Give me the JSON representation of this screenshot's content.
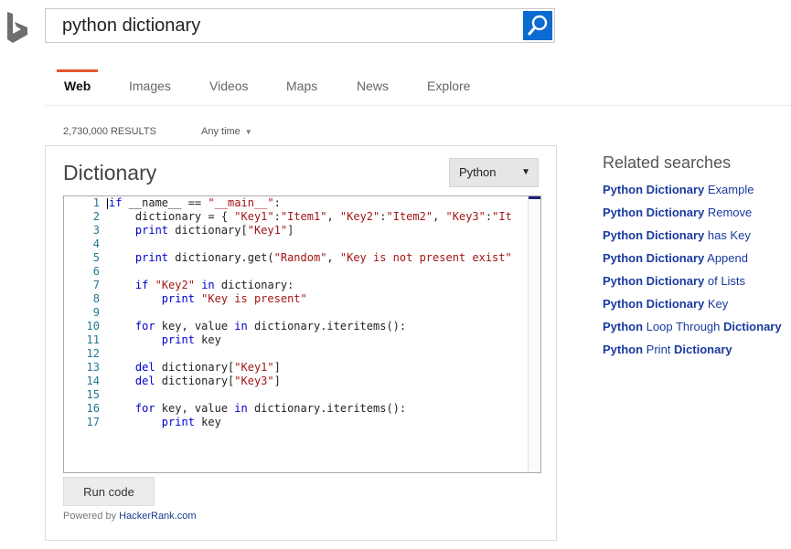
{
  "search": {
    "query": "python dictionary"
  },
  "tabs": [
    {
      "label": "Web",
      "active": true
    },
    {
      "label": "Images",
      "active": false
    },
    {
      "label": "Videos",
      "active": false
    },
    {
      "label": "Maps",
      "active": false
    },
    {
      "label": "News",
      "active": false
    },
    {
      "label": "Explore",
      "active": false
    }
  ],
  "results": {
    "count": "2,730,000 RESULTS",
    "time_filter": "Any time"
  },
  "answer": {
    "title": "Dictionary",
    "language": "Python",
    "run_label": "Run code",
    "powered_prefix": "Powered by ",
    "powered_link": "HackerRank.com",
    "code_lines": [
      {
        "n": "1",
        "parts": [
          [
            "kw",
            "if"
          ],
          [
            "t",
            " __name__ == "
          ],
          [
            "str",
            "\"__main__\""
          ],
          [
            "t",
            ":"
          ]
        ]
      },
      {
        "n": "2",
        "parts": [
          [
            "t",
            "    dictionary = { "
          ],
          [
            "str",
            "\"Key1\""
          ],
          [
            "t",
            ":"
          ],
          [
            "str",
            "\"Item1\""
          ],
          [
            "t",
            ", "
          ],
          [
            "str",
            "\"Key2\""
          ],
          [
            "t",
            ":"
          ],
          [
            "str",
            "\"Item2\""
          ],
          [
            "t",
            ", "
          ],
          [
            "str",
            "\"Key3\""
          ],
          [
            "t",
            ":"
          ],
          [
            "str",
            "\"It"
          ]
        ]
      },
      {
        "n": "3",
        "parts": [
          [
            "kw",
            "    print"
          ],
          [
            "t",
            " dictionary["
          ],
          [
            "str",
            "\"Key1\""
          ],
          [
            "t",
            "]"
          ]
        ]
      },
      {
        "n": "4",
        "parts": []
      },
      {
        "n": "5",
        "parts": [
          [
            "kw",
            "    print"
          ],
          [
            "t",
            " dictionary.get("
          ],
          [
            "str",
            "\"Random\""
          ],
          [
            "t",
            ", "
          ],
          [
            "str",
            "\"Key is not present exist\""
          ]
        ]
      },
      {
        "n": "6",
        "parts": []
      },
      {
        "n": "7",
        "parts": [
          [
            "kw",
            "    if"
          ],
          [
            "t",
            " "
          ],
          [
            "str",
            "\"Key2\""
          ],
          [
            "t",
            " "
          ],
          [
            "kw",
            "in"
          ],
          [
            "t",
            " dictionary:"
          ]
        ]
      },
      {
        "n": "8",
        "parts": [
          [
            "kw",
            "        print"
          ],
          [
            "t",
            " "
          ],
          [
            "str",
            "\"Key is present\""
          ]
        ]
      },
      {
        "n": "9",
        "parts": []
      },
      {
        "n": "10",
        "parts": [
          [
            "kw",
            "    for"
          ],
          [
            "t",
            " key, value "
          ],
          [
            "kw",
            "in"
          ],
          [
            "t",
            " dictionary.iteritems():"
          ]
        ]
      },
      {
        "n": "11",
        "parts": [
          [
            "kw",
            "        print"
          ],
          [
            "t",
            " key"
          ]
        ]
      },
      {
        "n": "12",
        "parts": []
      },
      {
        "n": "13",
        "parts": [
          [
            "kw",
            "    del"
          ],
          [
            "t",
            " dictionary["
          ],
          [
            "str",
            "\"Key1\""
          ],
          [
            "t",
            "]"
          ]
        ]
      },
      {
        "n": "14",
        "parts": [
          [
            "kw",
            "    del"
          ],
          [
            "t",
            " dictionary["
          ],
          [
            "str",
            "\"Key3\""
          ],
          [
            "t",
            "]"
          ]
        ]
      },
      {
        "n": "15",
        "parts": []
      },
      {
        "n": "16",
        "parts": [
          [
            "kw",
            "    for"
          ],
          [
            "t",
            " key, value "
          ],
          [
            "kw",
            "in"
          ],
          [
            "t",
            " dictionary.iteritems():"
          ]
        ]
      },
      {
        "n": "17",
        "parts": [
          [
            "kw",
            "        print"
          ],
          [
            "t",
            " key"
          ]
        ]
      }
    ]
  },
  "related": {
    "title": "Related searches",
    "items": [
      {
        "bold": "Python Dictionary",
        "rest": " Example"
      },
      {
        "bold": "Python Dictionary",
        "rest": " Remove"
      },
      {
        "bold": "Python Dictionary",
        "rest": " has Key"
      },
      {
        "bold": "Python Dictionary",
        "rest": " Append"
      },
      {
        "bold": "Python Dictionary",
        "rest": " of Lists"
      },
      {
        "bold": "Python Dictionary",
        "rest": " Key"
      },
      {
        "parts": [
          [
            "b",
            "Python"
          ],
          [
            "t",
            " Loop Through "
          ],
          [
            "b",
            "Dictionary"
          ]
        ]
      },
      {
        "parts": [
          [
            "b",
            "Python"
          ],
          [
            "t",
            " Print "
          ],
          [
            "b",
            "Dictionary"
          ]
        ]
      }
    ]
  },
  "colors": {
    "accent": "#e0562e",
    "search_button": "#0c6bd1",
    "link": "#1a3aa0",
    "keyword": "#0000cc",
    "string": "#a31515",
    "line_number": "#237893"
  },
  "icons": {
    "logo": "bing-logo-icon",
    "search": "magnifier-icon",
    "dropdown": "caret-down-icon"
  }
}
